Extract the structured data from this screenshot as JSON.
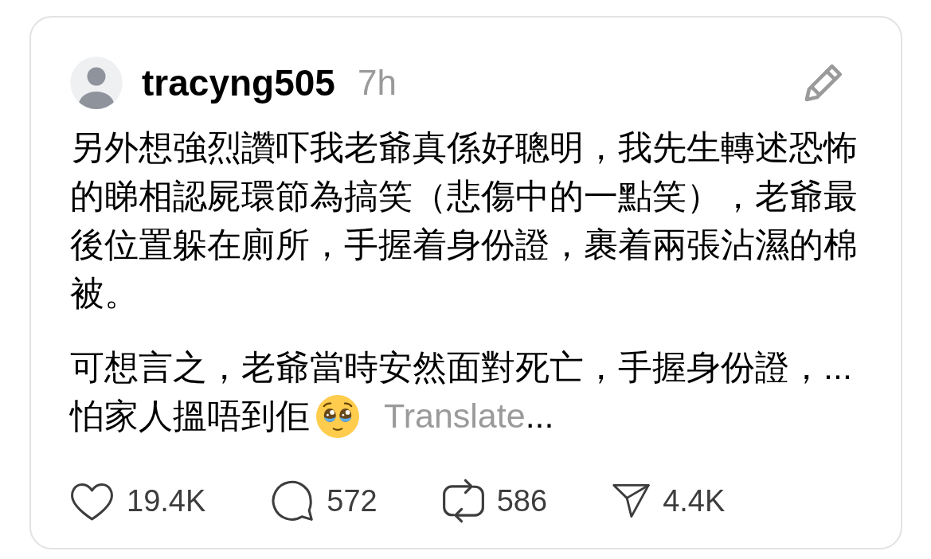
{
  "post": {
    "author": {
      "username": "tracyng505",
      "time": "7h"
    },
    "paragraphs": [
      "另外想強烈讚吓我老爺真係好聰明，我先生轉述恐怖的睇相認屍環節為搞笑（悲傷中的一點笑），老爺最後位置躲在廁所，手握着身份證，裹着兩張沾濕的棉被。"
    ],
    "excerpt": {
      "lines": [
        "可想言之，老爺當時安然面對死亡，手握身份證，...",
        "怕家人搵唔到佢"
      ],
      "translate_link": "Translate",
      "more": "..."
    },
    "actions": [
      {
        "kind": "like",
        "count": "19.4K"
      },
      {
        "kind": "reply",
        "count": "572"
      },
      {
        "kind": "repost",
        "count": "586"
      },
      {
        "kind": "share",
        "count": "4.4K"
      }
    ]
  }
}
